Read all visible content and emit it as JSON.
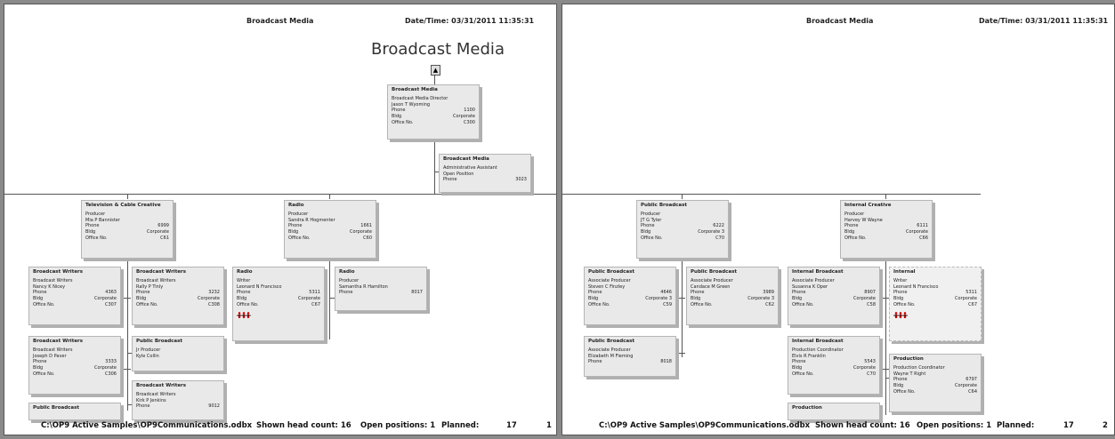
{
  "pages": [
    {
      "header_title": "Broadcast Media",
      "header_datetime": "Date/Time: 03/31/2011 11:35:31",
      "chart_title": "Broadcast Media",
      "up_icon": "up-arrow-icon",
      "footer": {
        "file": "C:\\OP9 Active Samples\\OP9Communications.odbx",
        "headcount": "Shown head count: 16",
        "open": "Open positions: 1",
        "planned_label": "Planned:",
        "planned_value": "17",
        "page_num": "1"
      },
      "boxes": [
        {
          "title": "Broadcast Media",
          "lines": [
            "Broadcast Media Director",
            "Jason T Wyoming"
          ],
          "rows": [
            [
              "Phone",
              "1100"
            ],
            [
              "Bldg",
              "Corporate"
            ],
            [
              "Office No.",
              "C300"
            ]
          ]
        },
        {
          "title": "Broadcast Media",
          "lines": [
            "Administrative Assistant",
            "Open Position"
          ],
          "rows": [
            [
              "Phone",
              "3023"
            ]
          ]
        },
        {
          "title": "Television & Cable Creative",
          "lines": [
            "Producer",
            "Mia P Bannister"
          ],
          "rows": [
            [
              "Phone",
              "6999"
            ],
            [
              "Bldg",
              "Corporate"
            ],
            [
              "Office No.",
              "C61"
            ]
          ]
        },
        {
          "title": "Radio",
          "lines": [
            "Producer",
            "Sandra R Hogmenter"
          ],
          "rows": [
            [
              "Phone",
              "1661"
            ],
            [
              "Bldg",
              "Corporate"
            ],
            [
              "Office No.",
              "C60"
            ]
          ]
        },
        {
          "title": "Broadcast Writers",
          "lines": [
            "Broadcast Writers",
            "Nancy K Nicey"
          ],
          "rows": [
            [
              "Phone",
              "4363"
            ],
            [
              "Bldg",
              "Corporate"
            ],
            [
              "Office No.",
              "C307"
            ]
          ]
        },
        {
          "title": "Broadcast Writers",
          "lines": [
            "Broadcast Writers",
            "Rally P Tinly"
          ],
          "rows": [
            [
              "Phone",
              "3232"
            ],
            [
              "Bldg",
              "Corporate"
            ],
            [
              "Office No.",
              "C308"
            ]
          ]
        },
        {
          "title": "Radio",
          "lines": [
            "Writer",
            "Leonard N Francisco"
          ],
          "rows": [
            [
              "Phone",
              "5311"
            ],
            [
              "Bldg",
              "Corporate"
            ],
            [
              "Office No.",
              "C67"
            ]
          ]
        },
        {
          "title": "Radio",
          "lines": [
            "Producer",
            "Samantha R Hamilton"
          ],
          "rows": [
            [
              "Phone",
              "8017"
            ]
          ]
        },
        {
          "title": "Broadcast Writers",
          "lines": [
            "Broadcast Writers",
            "Joseph D Paver"
          ],
          "rows": [
            [
              "Phone",
              "3333"
            ],
            [
              "Bldg",
              "Corporate"
            ],
            [
              "Office No.",
              "C306"
            ]
          ]
        },
        {
          "title": "Public Broadcast",
          "lines": [
            "Jr Producer",
            "Kyle Collin"
          ],
          "rows": []
        },
        {
          "title": "Broadcast Writers",
          "lines": [
            "Broadcast Writers",
            "Kirk P Jenkins"
          ],
          "rows": [
            [
              "Phone",
              "9012"
            ]
          ]
        },
        {
          "title": "Public Broadcast",
          "lines": [],
          "rows": []
        }
      ]
    },
    {
      "header_title": "Broadcast Media",
      "header_datetime": "Date/Time: 03/31/2011 11:35:31",
      "footer": {
        "file": "C:\\OP9 Active Samples\\OP9Communications.odbx",
        "headcount": "Shown head count: 16",
        "open": "Open positions: 1",
        "planned_label": "Planned:",
        "planned_value": "17",
        "page_num": "2"
      },
      "boxes": [
        {
          "title": "Public Broadcast",
          "lines": [
            "Producer",
            "JT G Tyler"
          ],
          "rows": [
            [
              "Phone",
              "6222"
            ],
            [
              "Bldg",
              "Corporate 3"
            ],
            [
              "Office No.",
              "C70"
            ]
          ]
        },
        {
          "title": "Internal Creative",
          "lines": [
            "Producer",
            "Harvey W Wayne"
          ],
          "rows": [
            [
              "Phone",
              "6111"
            ],
            [
              "Bldg",
              "Corporate"
            ],
            [
              "Office No.",
              "C66"
            ]
          ]
        },
        {
          "title": "Public Broadcast",
          "lines": [
            "Associate Producer",
            "Steven C Finzley"
          ],
          "rows": [
            [
              "Phone",
              "4646"
            ],
            [
              "Bldg",
              "Corporate 3"
            ],
            [
              "Office No.",
              "C59"
            ]
          ]
        },
        {
          "title": "Public Broadcast",
          "lines": [
            "Associate Producer",
            "Candace M Green"
          ],
          "rows": [
            [
              "Phone",
              "3989"
            ],
            [
              "Bldg",
              "Corporate 3"
            ],
            [
              "Office No.",
              "C62"
            ]
          ]
        },
        {
          "title": "Internal Broadcast",
          "lines": [
            "Associate Producer",
            "Susanna K Oper"
          ],
          "rows": [
            [
              "Phone",
              "8907"
            ],
            [
              "Bldg",
              "Corporate"
            ],
            [
              "Office No.",
              "C58"
            ]
          ]
        },
        {
          "title": "Internal",
          "lines": [
            "Writer",
            "Leonard N Francisco"
          ],
          "rows": [
            [
              "Phone",
              "5311"
            ],
            [
              "Bldg",
              "Corporate"
            ],
            [
              "Office No.",
              "C67"
            ]
          ]
        },
        {
          "title": "Public Broadcast",
          "lines": [
            "Associate Producer",
            "Elizabeth M Fleming"
          ],
          "rows": [
            [
              "Phone",
              "8018"
            ]
          ]
        },
        {
          "title": "Internal Broadcast",
          "lines": [
            "Production Coordinator",
            "Elvis R Franklin"
          ],
          "rows": [
            [
              "Phone",
              "5543"
            ],
            [
              "Bldg",
              "Corporate"
            ],
            [
              "Office No.",
              "C70"
            ]
          ]
        },
        {
          "title": "Production",
          "lines": [
            "Production Coordinator",
            "Wayne T Right"
          ],
          "rows": [
            [
              "Phone",
              "6797"
            ],
            [
              "Bldg",
              "Corporate"
            ],
            [
              "Office No.",
              "C64"
            ]
          ]
        },
        {
          "title": "Production",
          "lines": [],
          "rows": []
        }
      ]
    }
  ]
}
